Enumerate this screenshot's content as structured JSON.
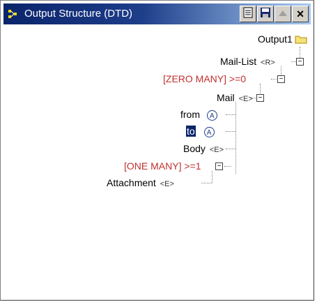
{
  "window": {
    "title": "Output Structure (DTD)"
  },
  "toolbar": {
    "doc_icon": "document-icon",
    "save_icon": "save-icon",
    "up_icon": "up-arrow-icon",
    "close_label": "×"
  },
  "tree": {
    "root": {
      "label": "Output1",
      "icon": "folder-icon"
    },
    "mail_list": {
      "label": "Mail-List",
      "badge": "<R>"
    },
    "zero_many": {
      "label": "[ZERO MANY]",
      "cond": ">=0"
    },
    "mail": {
      "label": "Mail",
      "badge": "<E>"
    },
    "from": {
      "label": "from",
      "badge": "A"
    },
    "to": {
      "label": "to",
      "badge": "A"
    },
    "body": {
      "label": "Body",
      "badge": "<E>"
    },
    "one_many": {
      "label": "[ONE MANY]",
      "cond": ">=1"
    },
    "attachment": {
      "label": "Attachment",
      "badge": "<E>"
    }
  },
  "colors": {
    "titlebar_start": "#0a246a",
    "titlebar_end": "#a6caf0",
    "occurrence_text": "#c0312f",
    "selection": "#0a246a"
  }
}
